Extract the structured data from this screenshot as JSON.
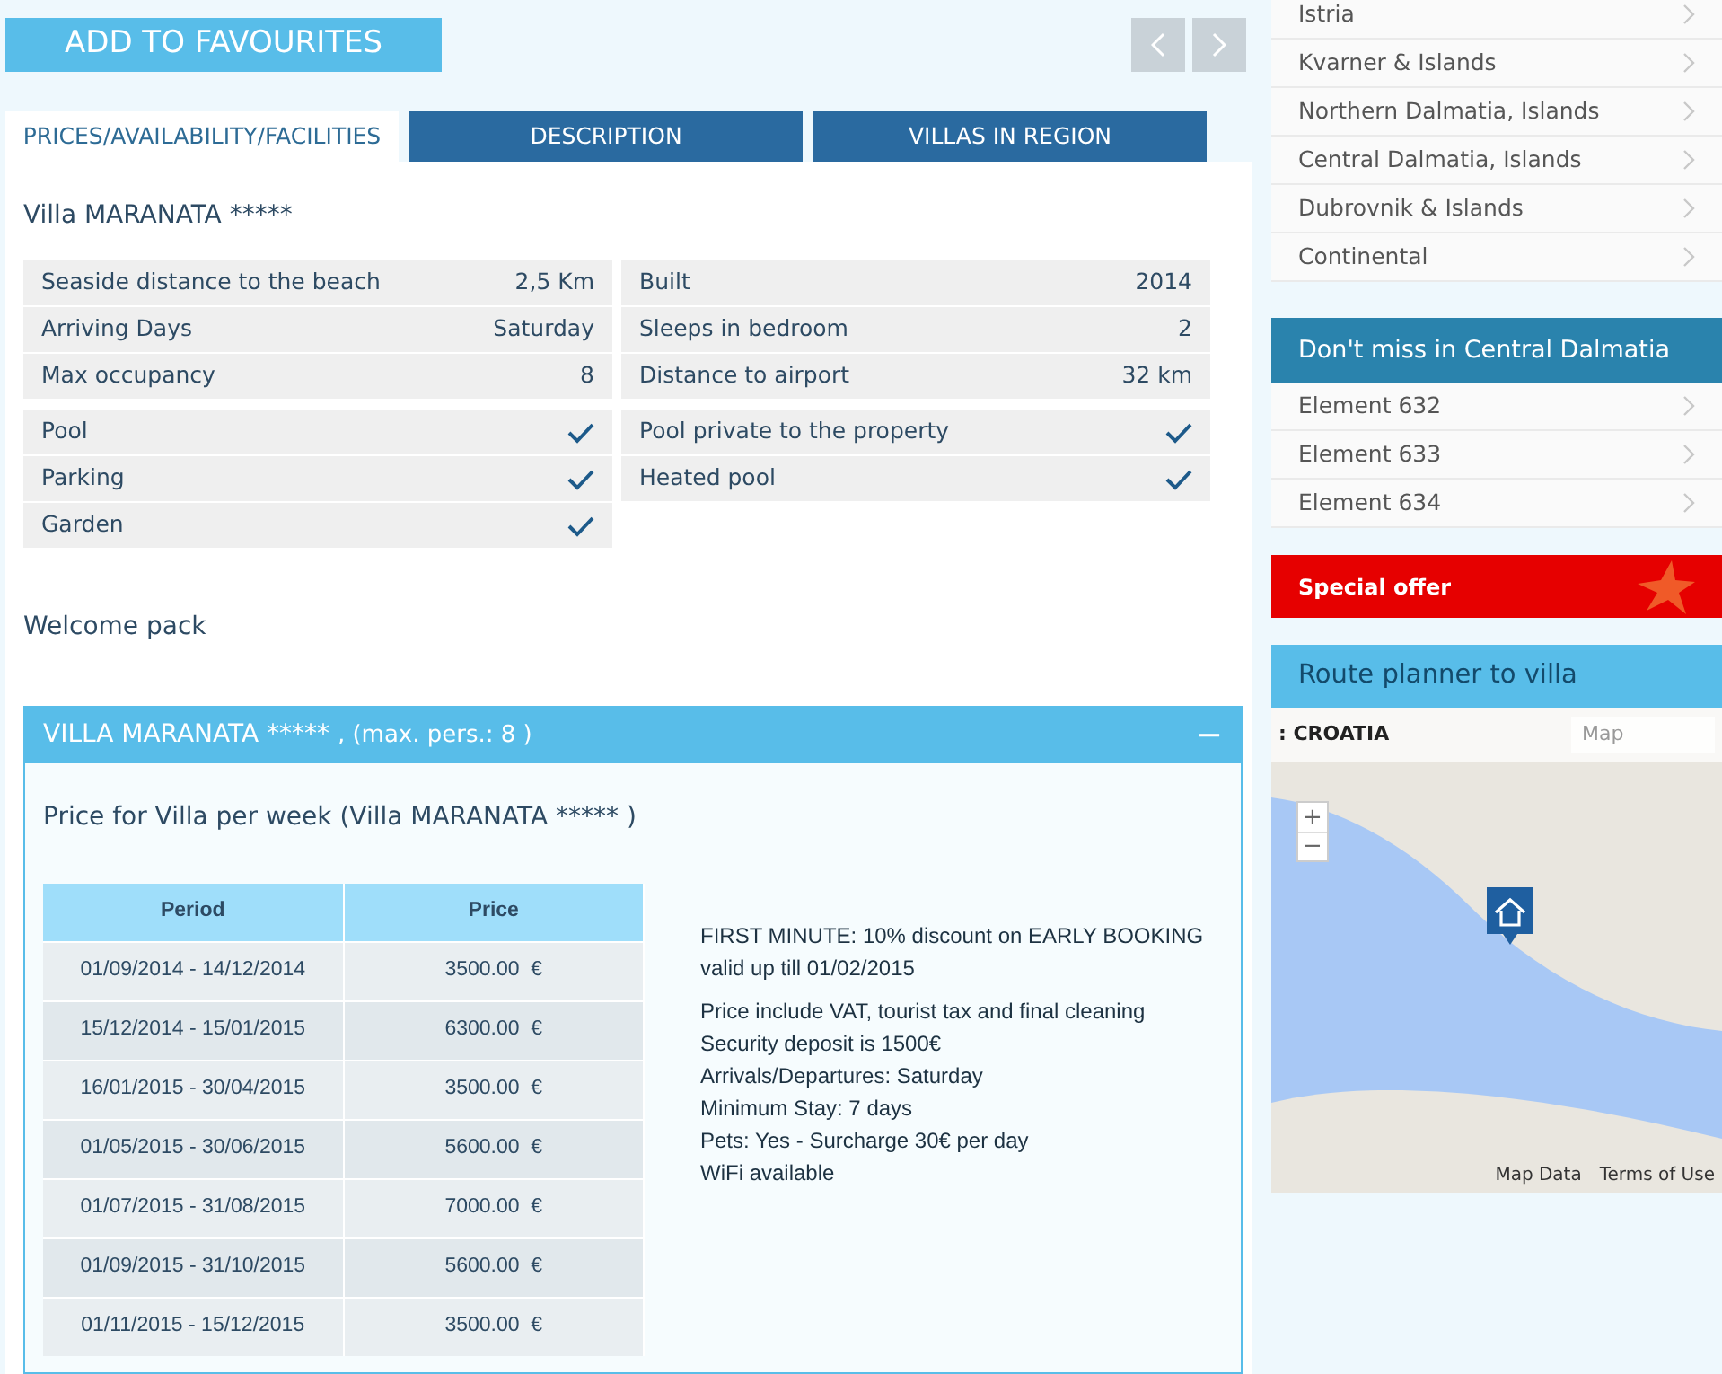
{
  "favourites_button": {
    "label": "ADD TO FAVOURITES"
  },
  "nav_arrows": [
    {
      "disabled": true
    },
    {
      "disabled": true
    }
  ],
  "tabs": [
    {
      "label": "PRICES/AVAILABILITY/FACILITIES",
      "selected": true
    },
    {
      "label": "DESCRIPTION",
      "selected": false
    },
    {
      "label": "VILLAS IN REGION",
      "selected": false
    }
  ],
  "villa_title": "Villa MARANATA *****",
  "facts_left": [
    {
      "kind": "value",
      "label": "Seaside distance to the beach",
      "value": "2,5 Km"
    },
    {
      "kind": "value",
      "label": "Arriving Days",
      "value": "Saturday"
    },
    {
      "kind": "value",
      "label": "Max occupancy",
      "value": "8"
    }
  ],
  "facts_right": [
    {
      "kind": "value",
      "label": "Built",
      "value": "2014"
    },
    {
      "kind": "value",
      "label": "Sleeps in bedroom",
      "value": "2"
    },
    {
      "kind": "value",
      "label": "Distance to airport",
      "value": "32 km"
    }
  ],
  "amenities_left": [
    {
      "kind": "check",
      "label": "Pool",
      "checked": true
    },
    {
      "kind": "check",
      "label": "Parking",
      "checked": true
    },
    {
      "kind": "check",
      "label": "Garden",
      "checked": true
    }
  ],
  "amenities_right": [
    {
      "kind": "check",
      "label": "Pool private to the property",
      "checked": true
    },
    {
      "kind": "check",
      "label": "Heated pool",
      "checked": true
    }
  ],
  "welcome_pack": "Welcome pack",
  "price_panel": {
    "title": "VILLA MARANATA *****",
    "subtitle": ", (max. pers.: 8 )",
    "expanded": true,
    "toggle": "−",
    "heading": "Price for Villa per week (Villa MARANATA ***** )",
    "columns": [
      "Period",
      "Price"
    ],
    "rows": [
      [
        "01/09/2014 - 14/12/2014",
        "3500.00  €"
      ],
      [
        "15/12/2014 - 15/01/2015",
        "6300.00  €"
      ],
      [
        "16/01/2015 - 30/04/2015",
        "3500.00  €"
      ],
      [
        "01/05/2015 - 30/06/2015",
        "5600.00  €"
      ],
      [
        "01/07/2015 - 31/08/2015",
        "7000.00  €"
      ],
      [
        "01/09/2015 - 31/10/2015",
        "5600.00  €"
      ],
      [
        "01/11/2015 - 15/12/2015",
        "3500.00  €"
      ]
    ],
    "notes": [
      [
        "FIRST MINUTE: 10% discount on EARLY BOOKING",
        "valid up till 01/02/2015"
      ],
      [
        "Price include VAT, tourist tax and final cleaning",
        "Security deposit is 1500€",
        "Arrivals/Departures: Saturday",
        "Minimum Stay: 7 days",
        "Pets: Yes - Surcharge 30€ per day",
        "WiFi available"
      ]
    ]
  },
  "regions": [
    "Istria",
    "Kvarner & Islands",
    "Northern Dalmatia, Islands",
    "Central Dalmatia, Islands",
    "Dubrovnik & Islands",
    "Continental"
  ],
  "dont_miss": {
    "title": "Don't miss in Central Dalmatia",
    "items": [
      "Element 632",
      "Element 633",
      "Element 634"
    ]
  },
  "special_offer": "Special offer",
  "route_planner": {
    "title": "Route planner to villa",
    "country": ": CROATIA",
    "map_type": "Map",
    "zoom_in": "+",
    "zoom_out": "−",
    "attribution": [
      "Map Data",
      "Terms of Use"
    ]
  }
}
